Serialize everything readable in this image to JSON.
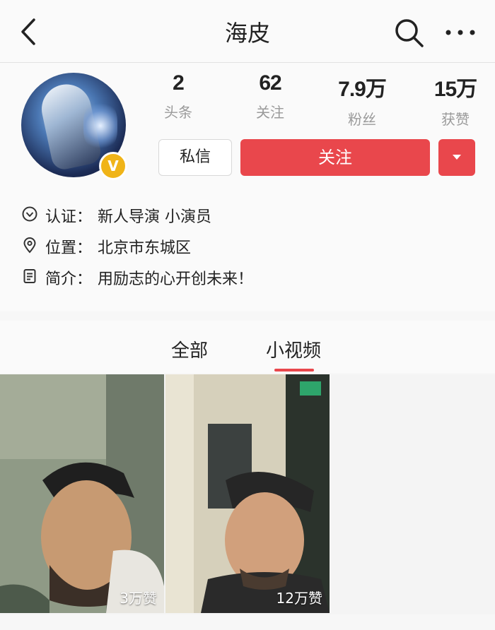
{
  "header": {
    "title": "海皮",
    "back_icon": "chevron-left-icon",
    "search_icon": "search-icon",
    "more_icon": "more-horizontal-icon"
  },
  "profile": {
    "avatar_icon": "avatar",
    "verified_badge": "V",
    "stats": [
      {
        "value": "2",
        "label": "头条"
      },
      {
        "value": "62",
        "label": "关注"
      },
      {
        "value": "7.9万",
        "label": "粉丝"
      },
      {
        "value": "15万",
        "label": "获赞"
      }
    ],
    "message_label": "私信",
    "follow_label": "关注",
    "accent_color": "#e9474c",
    "verified_color": "#f0b418"
  },
  "info": [
    {
      "icon": "verified-check-icon",
      "label": "认证：",
      "value": "新人导演 小演员"
    },
    {
      "icon": "location-pin-icon",
      "label": "位置：",
      "value": "北京市东城区"
    },
    {
      "icon": "document-icon",
      "label": "简介：",
      "value": "用励志的心开创未来！"
    }
  ],
  "tabs": [
    {
      "label": "全部",
      "active": false
    },
    {
      "label": "小视频",
      "active": true
    }
  ],
  "videos": [
    {
      "likes": "3万赞"
    },
    {
      "likes": "12万赞"
    }
  ]
}
